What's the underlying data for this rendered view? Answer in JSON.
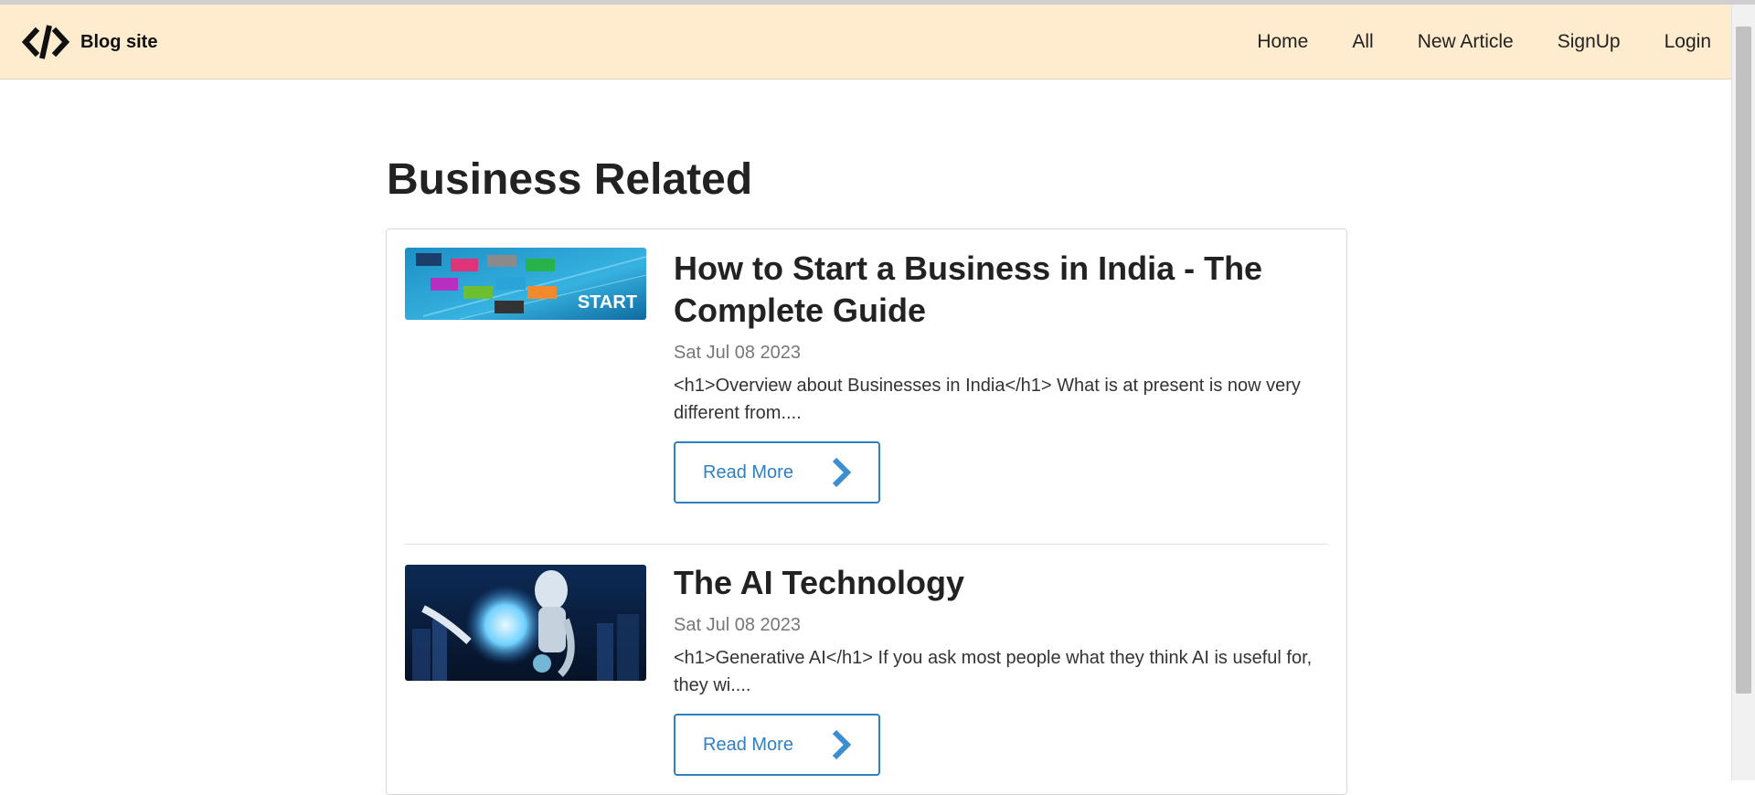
{
  "navbar": {
    "brand": "Blog site",
    "brand_icon": "code-icon",
    "background": "#ffebcd",
    "items": [
      {
        "label": "Home"
      },
      {
        "label": "All"
      },
      {
        "label": "New Article"
      },
      {
        "label": "SignUp"
      },
      {
        "label": "Login"
      }
    ]
  },
  "page": {
    "title": "Business Related"
  },
  "articles": [
    {
      "title": "How to Start a Business in India - The Complete Guide",
      "date": "Sat Jul 08 2023",
      "excerpt": "<h1>Overview about Businesses in India</h1> What is at present is now very different from....",
      "button": "Read More",
      "thumbnail_word": "START",
      "thumbnail_icon": "business-start-thumbnail"
    },
    {
      "title": "The AI Technology",
      "date": "Sat Jul 08 2023",
      "excerpt": "<h1>Generative AI</h1> If you ask most people what they think AI is useful for, they wi....",
      "button": "Read More",
      "thumbnail_icon": "ai-robot-thumbnail"
    }
  ],
  "colors": {
    "accent": "#2f7fc1",
    "text": "#222222",
    "muted": "#777777"
  }
}
